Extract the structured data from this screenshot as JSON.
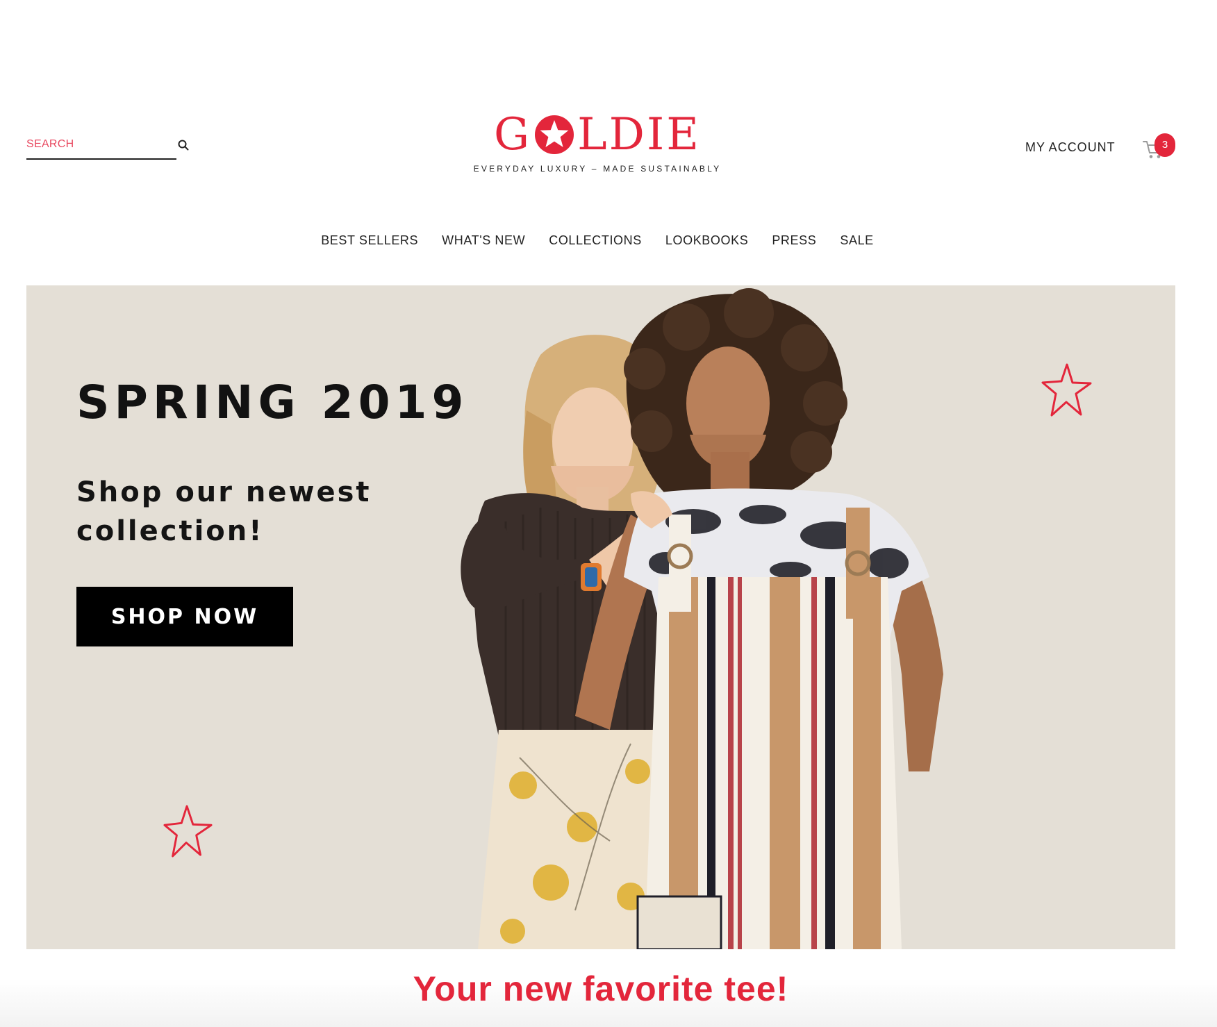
{
  "header": {
    "search": {
      "placeholder": "SEARCH",
      "value": ""
    },
    "logo": {
      "prefix": "G",
      "suffix": "LDIE",
      "tagline": "EVERYDAY LUXURY – MADE SUSTAINABLY"
    },
    "account_label": "MY ACCOUNT",
    "cart": {
      "count": "3"
    }
  },
  "nav": {
    "items": [
      {
        "label": "BEST SELLERS"
      },
      {
        "label": "WHAT'S NEW"
      },
      {
        "label": "COLLECTIONS"
      },
      {
        "label": "LOOKBOOKS"
      },
      {
        "label": "PRESS"
      },
      {
        "label": "SALE"
      }
    ]
  },
  "hero": {
    "title": "SPRING 2019",
    "subtitle": "Shop our newest collection!",
    "cta_label": "SHOP NOW",
    "background_color": "#e4dfd6"
  },
  "section": {
    "heading": "Your new favorite tee!"
  },
  "colors": {
    "brand": "#e3263b",
    "text": "#222222",
    "button": "#000000"
  },
  "icons": [
    "search-icon",
    "star-icon",
    "cart-icon"
  ]
}
